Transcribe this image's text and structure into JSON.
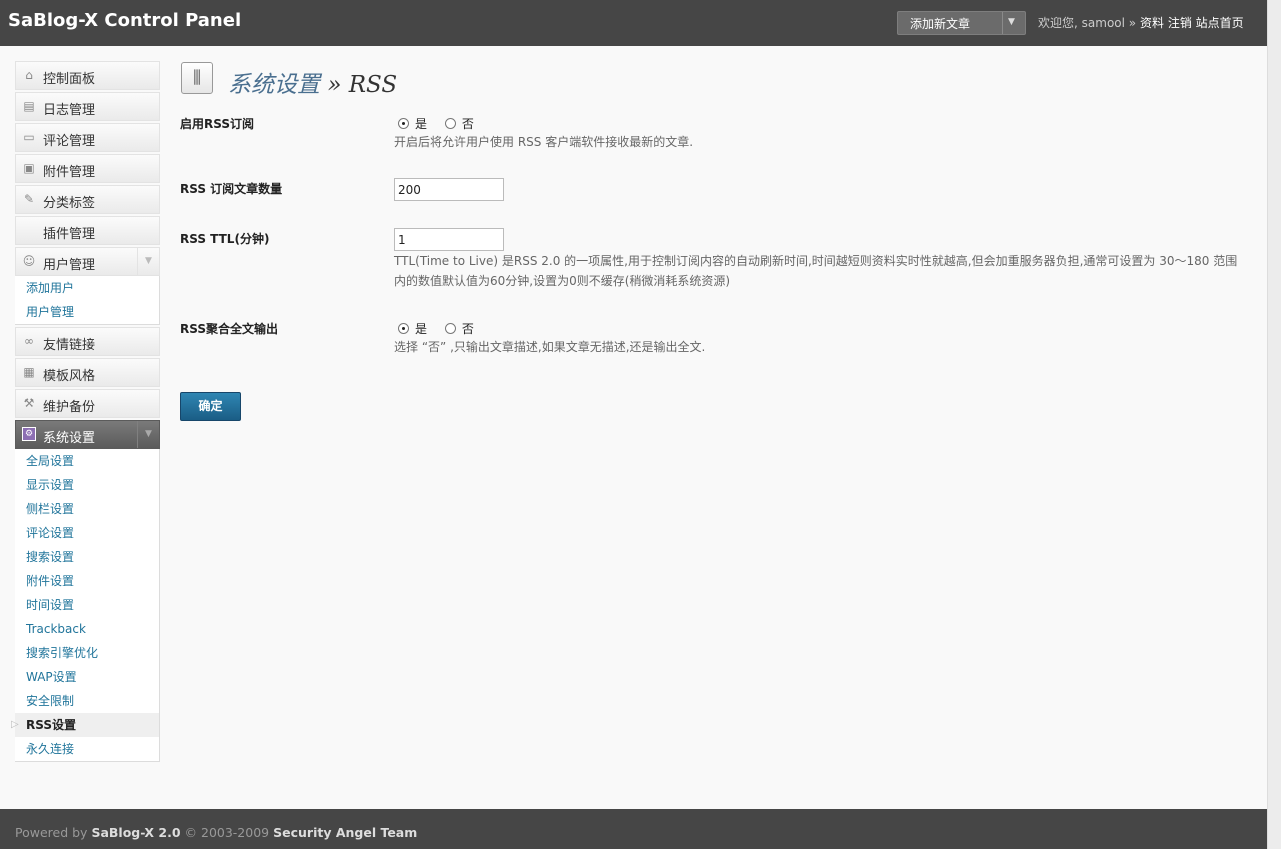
{
  "header": {
    "title": "SaBlog-X Control Panel",
    "new_post_label": "添加新文章",
    "welcome": "欢迎您,",
    "username": "samool",
    "separator": "»",
    "profile": "资料",
    "logout": "注销",
    "site_home": "站点首页"
  },
  "sidebar": {
    "items": [
      {
        "label": "控制面板",
        "icon": "home-icon"
      },
      {
        "label": "日志管理",
        "icon": "posts-icon"
      },
      {
        "label": "评论管理",
        "icon": "comments-icon"
      },
      {
        "label": "附件管理",
        "icon": "attachments-icon"
      },
      {
        "label": "分类标签",
        "icon": "pin-icon"
      },
      {
        "label": "插件管理",
        "icon": ""
      },
      {
        "label": "用户管理",
        "icon": "users-icon"
      },
      {
        "label": "友情链接",
        "icon": "link-icon"
      },
      {
        "label": "模板风格",
        "icon": "template-icon"
      },
      {
        "label": "维护备份",
        "icon": "tools-icon"
      },
      {
        "label": "系统设置",
        "icon": "settings-icon"
      }
    ],
    "users_sub": [
      "添加用户",
      "用户管理"
    ],
    "settings_sub": [
      "全局设置",
      "显示设置",
      "侧栏设置",
      "评论设置",
      "搜索设置",
      "附件设置",
      "时间设置",
      "Trackback",
      "搜索引擎优化",
      "WAP设置",
      "安全限制",
      "RSS设置",
      "永久连接"
    ]
  },
  "page": {
    "section": "系统设置",
    "separator": "»",
    "title": "RSS"
  },
  "options": {
    "enable_rss": {
      "label": "启用RSS订阅",
      "yes": "是",
      "no": "否",
      "selected": "是",
      "desc": "开启后将允许用户使用  RSS 客户端软件接收最新的文章."
    },
    "rss_count": {
      "label": "RSS 订阅文章数量",
      "value": "200"
    },
    "rss_ttl": {
      "label": "RSS TTL(分钟)",
      "value": "1",
      "desc_line1": "TTL(Time to Live) 是RSS 2.0 的一项属性,用于控制订阅内容的自动刷新时间,时间越短则资料实时性就越高,但会加重服务器负担,通常可设置为  30～180 范围",
      "desc_line2": "内的数值默认值为60分钟,设置为0则不缓存(稍微消耗系统资源)"
    },
    "rss_fulltext": {
      "label": "RSS聚合全文输出",
      "yes": "是",
      "no": "否",
      "selected": "是",
      "desc": "选择 “否” ,只输出文章描述,如果文章无描述,还是输出全文."
    }
  },
  "submit_label": "确定",
  "footer": {
    "powered": "Powered by",
    "product": "SaBlog-X 2.0",
    "copyright": "© 2003-2009",
    "team": "Security Angel Team"
  }
}
